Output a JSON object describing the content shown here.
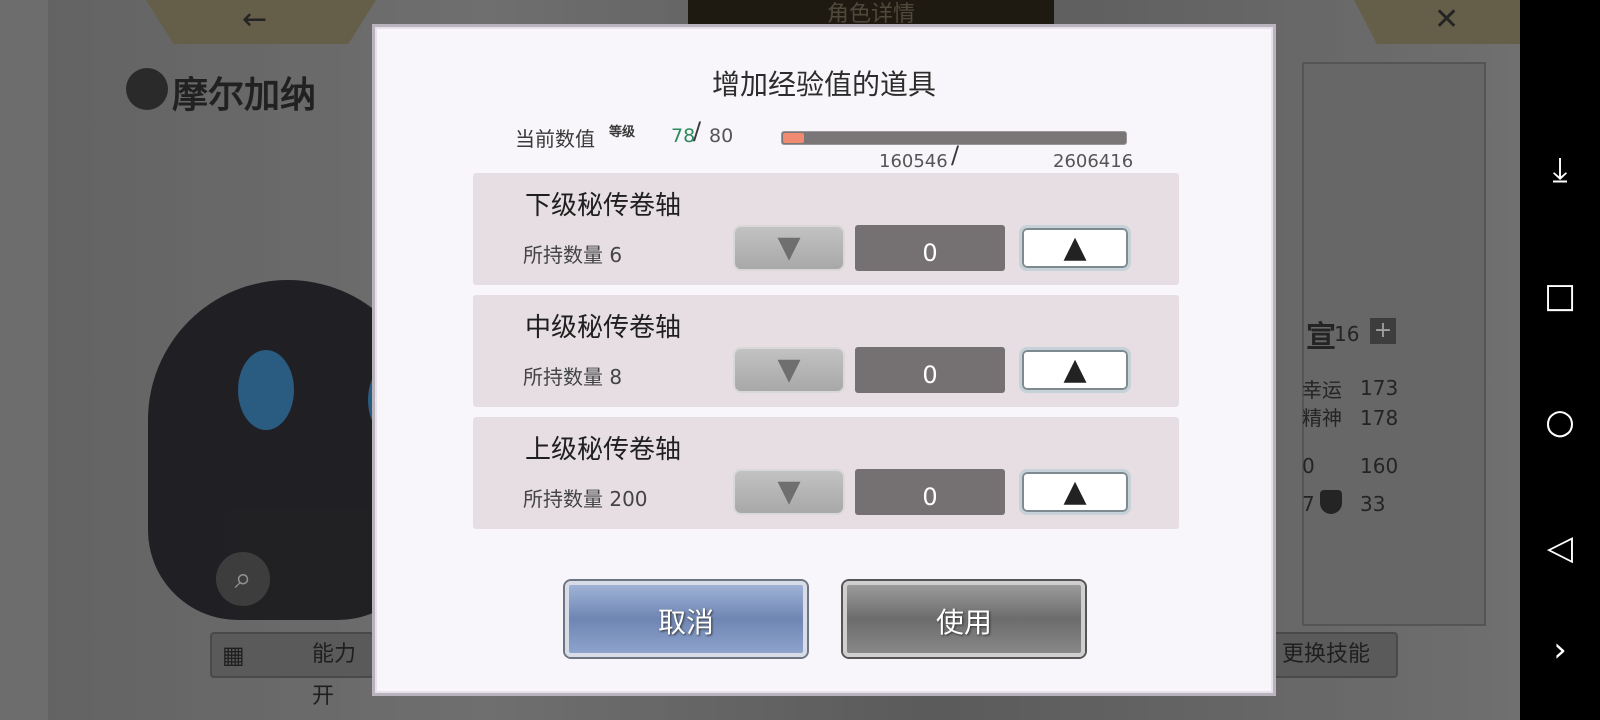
{
  "background": {
    "top_title": "角色详情",
    "character_name": "摩尔加纳",
    "right_stats": {
      "level_value": "16",
      "luck_label": "幸运",
      "luck_value": "173",
      "spirit_label": "精神",
      "spirit_value": "178",
      "stat_a_value": "160",
      "stat_b_value": "33",
      "partial_a": "0",
      "partial_b": "7",
      "char_fragment": "宣"
    },
    "bottom_left_button": "能力开",
    "bottom_right_button": "更换技能"
  },
  "dialog": {
    "title": "增加经验值的道具",
    "current_label": "当前数值",
    "level_label": "等级",
    "level_current": "78",
    "level_slash": "/",
    "level_max": "80",
    "exp_current": "160546",
    "exp_slash": "/",
    "exp_max": "2606416",
    "exp_progress_fraction": 0.0616,
    "items": [
      {
        "name": "下级秘传卷轴",
        "count": "所持数量 6",
        "quantity": "0"
      },
      {
        "name": "中级秘传卷轴",
        "count": "所持数量 8",
        "quantity": "0"
      },
      {
        "name": "上级秘传卷轴",
        "count": "所持数量 200",
        "quantity": "0"
      }
    ],
    "cancel_label": "取消",
    "use_label": "使用",
    "down_glyph": "▼",
    "up_glyph": "▲"
  },
  "navbar": {
    "icons": [
      "download-icon",
      "square-icon",
      "circle-icon",
      "back-triangle-icon",
      "chevron-right-icon"
    ],
    "glyphs": [
      "⤓",
      "□",
      "○",
      "◁",
      "›"
    ]
  },
  "colors": {
    "level_current": "#2e8a5e",
    "exp_fill": "#f08a70"
  }
}
